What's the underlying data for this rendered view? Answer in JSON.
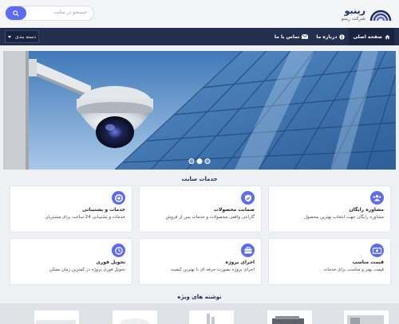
{
  "brand": {
    "title": "رینبو",
    "subtitle": "شرکت رینبو"
  },
  "search": {
    "placeholder": "جستجو در سایت"
  },
  "nav": {
    "items": [
      {
        "label": "صفحه اصلی",
        "icon": "home-icon"
      },
      {
        "label": "درباره ما",
        "icon": "info-icon"
      },
      {
        "label": "تماس با ما",
        "icon": "envelope-icon"
      }
    ],
    "category_label": "دسته بندی"
  },
  "slider": {
    "slides": 3,
    "active": 2
  },
  "services": {
    "title": "خدمات سایت",
    "items": [
      {
        "title": "مشاوره رایگان",
        "desc": "مشاوره رایگان جهت انتخاب بهترین محصول",
        "icon": "users-icon"
      },
      {
        "title": "ضمانت محصولات",
        "desc": "گارانتی واقعی محصولات و خدمات پس از فروش",
        "icon": "badge-check-icon"
      },
      {
        "title": "خدمات و پشتیبانی",
        "desc": "خدمات و پشتیبانی 24 ساعت برای مشتریان",
        "icon": "support-icon"
      },
      {
        "title": "قیمت مناسب",
        "desc": "قیمت بهتر و مناسب برای خدمات",
        "icon": "money-icon"
      },
      {
        "title": "اجرای پروژه",
        "desc": "اجرای پروژه بصورت حرفه ای با بهترین کیفیت",
        "icon": "briefcase-icon"
      },
      {
        "title": "تحویل فوری",
        "desc": "تحویل فوری پروژه در کمترین زمان ممکن",
        "icon": "clock-icon"
      }
    ]
  },
  "featured": {
    "title": "نوشته های ویژه"
  },
  "colors": {
    "accent": "#5b6cf0",
    "nav": "#242f4f",
    "brand": "#1f2a5c"
  }
}
